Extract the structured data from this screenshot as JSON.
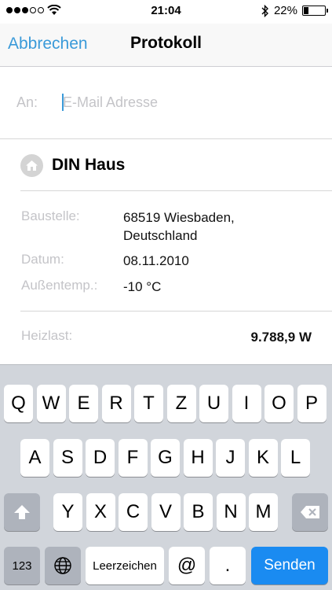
{
  "status_bar": {
    "time": "21:04",
    "battery_percent": "22%",
    "battery_level": 0.22,
    "signal_dots": 5,
    "signal_filled": 3
  },
  "nav": {
    "cancel_label": "Abbrechen",
    "title": "Protokoll"
  },
  "recipient": {
    "label": "An:",
    "placeholder": "E-Mail Adresse",
    "value": ""
  },
  "project": {
    "name": "DIN Haus",
    "icon": "house-icon"
  },
  "details": {
    "baustelle_label": "Baustelle:",
    "baustelle_line1": "68519 Wiesbaden,",
    "baustelle_line2": "Deutschland",
    "datum_label": "Datum:",
    "datum_value": "08.11.2010",
    "aussentemp_label": "Außentemp.:",
    "aussentemp_value": "-10 °C"
  },
  "summary": {
    "heizlast_label": "Heizlast:",
    "heizlast_value": "9.788,9 W"
  },
  "keyboard": {
    "row1": [
      "Q",
      "W",
      "E",
      "R",
      "T",
      "Z",
      "U",
      "I",
      "O",
      "P"
    ],
    "row2": [
      "A",
      "S",
      "D",
      "F",
      "G",
      "H",
      "J",
      "K",
      "L"
    ],
    "row3": [
      "Y",
      "X",
      "C",
      "V",
      "B",
      "N",
      "M"
    ],
    "numbers_label": "123",
    "space_label": "Leerzeichen",
    "at_label": "@",
    "dot_label": ".",
    "send_label": "Senden",
    "colors": {
      "background": "#d1d5db",
      "send": "#1a8bf1",
      "accent": "#3a9ad9"
    }
  }
}
